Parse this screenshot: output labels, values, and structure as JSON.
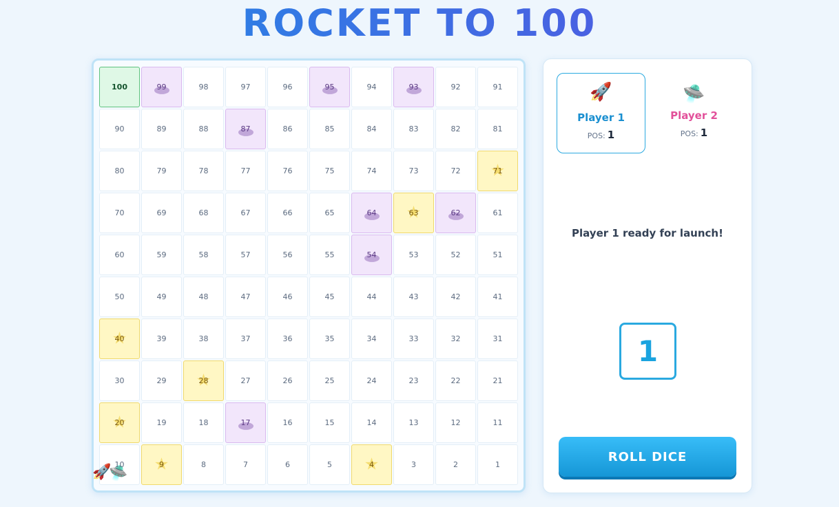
{
  "title": "ROCKET TO 100",
  "board": {
    "rows": [
      [
        100,
        99,
        98,
        97,
        96,
        95,
        94,
        93,
        92,
        91
      ],
      [
        90,
        89,
        88,
        87,
        86,
        85,
        84,
        83,
        82,
        81
      ],
      [
        80,
        79,
        78,
        77,
        76,
        75,
        74,
        73,
        72,
        71
      ],
      [
        70,
        69,
        68,
        67,
        66,
        65,
        64,
        63,
        62,
        61
      ],
      [
        60,
        59,
        58,
        57,
        56,
        55,
        54,
        53,
        52,
        51
      ],
      [
        50,
        49,
        48,
        47,
        46,
        45,
        44,
        43,
        42,
        41
      ],
      [
        40,
        39,
        38,
        37,
        36,
        35,
        34,
        33,
        32,
        31
      ],
      [
        30,
        29,
        28,
        27,
        26,
        25,
        24,
        23,
        22,
        21
      ],
      [
        20,
        19,
        18,
        17,
        16,
        15,
        14,
        13,
        12,
        11
      ],
      [
        10,
        9,
        8,
        7,
        6,
        5,
        4,
        3,
        2,
        1
      ]
    ],
    "planet_cells": [
      99,
      95,
      93,
      87,
      64,
      62,
      54,
      17
    ],
    "star_cells": [
      71,
      63,
      40,
      28,
      20,
      9,
      4
    ],
    "goal_cell": 100
  },
  "players": [
    {
      "name": "Player 1",
      "pos_label": "POS:",
      "position": 1,
      "icon": "rocket-icon",
      "glyph": "🚀",
      "color": "#1a8fd0",
      "active": true
    },
    {
      "name": "Player 2",
      "pos_label": "POS:",
      "position": 1,
      "icon": "ufo-icon",
      "glyph": "🛸",
      "color": "#e2509a",
      "active": false
    }
  ],
  "status_text": "Player 1 ready for launch!",
  "dice_value": "1",
  "roll_button": "ROLL DICE",
  "colors": {
    "accent": "#2aa9e0",
    "planet": "#f2e6fb",
    "star": "#fff7c4",
    "goal": "#dff8e6"
  }
}
